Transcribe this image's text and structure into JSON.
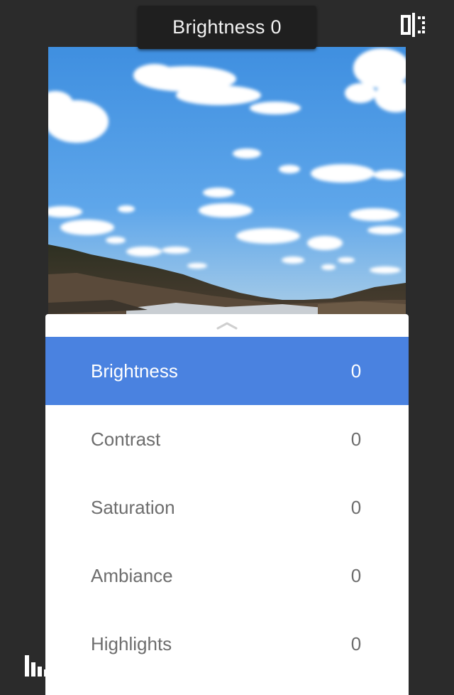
{
  "header": {
    "title": "Brightness 0",
    "compare_icon": "compare-split-icon"
  },
  "photo": {
    "subject": "landscape-photo"
  },
  "sheet": {
    "handle_icon": "chevron-up-icon",
    "items": [
      {
        "label": "Brightness",
        "value": "0",
        "selected": true
      },
      {
        "label": "Contrast",
        "value": "0",
        "selected": false
      },
      {
        "label": "Saturation",
        "value": "0",
        "selected": false
      },
      {
        "label": "Ambiance",
        "value": "0",
        "selected": false
      },
      {
        "label": "Highlights",
        "value": "0",
        "selected": false
      }
    ]
  },
  "footer": {
    "histogram_icon": "histogram-icon"
  },
  "colors": {
    "background": "#2b2b2b",
    "accent": "#4a82e0",
    "sheet": "#ffffff",
    "label": "#6d6d6d"
  }
}
